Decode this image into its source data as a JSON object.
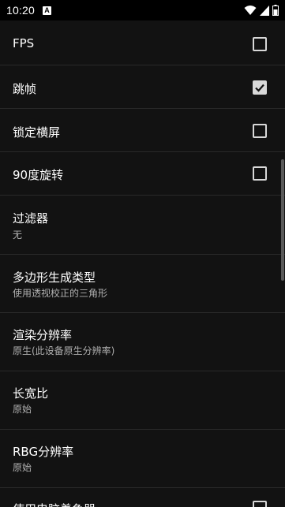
{
  "status_bar": {
    "time": "10:20",
    "notification_icon": "A"
  },
  "settings": [
    {
      "title": "FPS",
      "type": "checkbox",
      "checked": false
    },
    {
      "title": "跳帧",
      "type": "checkbox",
      "checked": true
    },
    {
      "title": "锁定横屏",
      "type": "checkbox",
      "checked": false
    },
    {
      "title": "90度旋转",
      "type": "checkbox",
      "checked": false
    },
    {
      "title": "过滤器",
      "subtitle": "无",
      "type": "option"
    },
    {
      "title": "多边形生成类型",
      "subtitle": "使用透视校正的三角形",
      "type": "option"
    },
    {
      "title": "渲染分辨率",
      "subtitle": "原生(此设备原生分辨率)",
      "type": "option"
    },
    {
      "title": "长宽比",
      "subtitle": "原始",
      "type": "option"
    },
    {
      "title": "RBG分辨率",
      "subtitle": "原始",
      "type": "option"
    },
    {
      "title": "使用电脑着色器",
      "type": "checkbox",
      "checked": false
    }
  ],
  "colors": {
    "background": "#121212",
    "divider": "#2a2a2a",
    "subtitle": "#b0b0b0",
    "checkbox": "#d8d8d8"
  }
}
